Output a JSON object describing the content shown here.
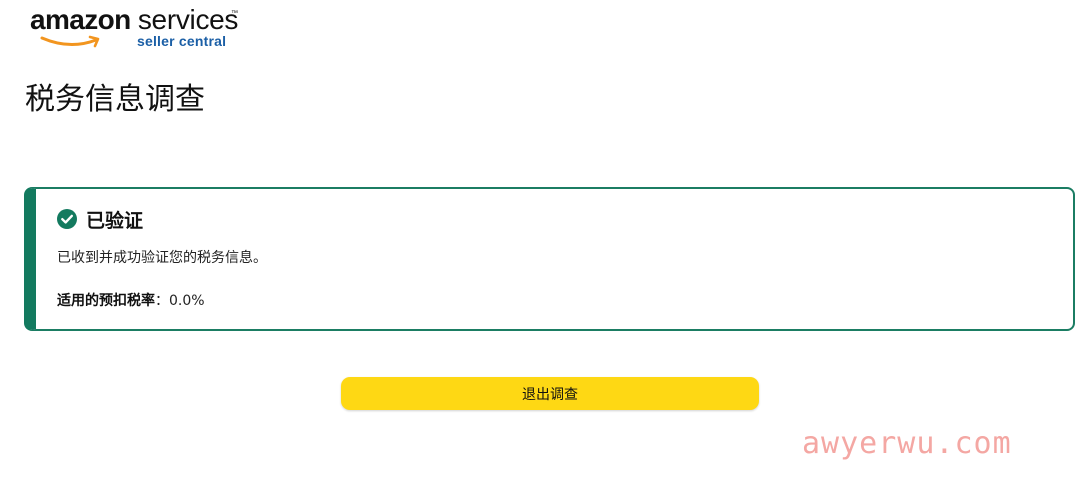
{
  "logo": {
    "brand": "amazon",
    "services": "services",
    "trademark": "™",
    "subtitle": "seller central",
    "subtitle_color": "#1b5fa6",
    "smile_color": "#f2951f"
  },
  "page": {
    "title": "税务信息调查"
  },
  "alert": {
    "icon": "check-circle-icon",
    "status_color": "#137a5f",
    "title": "已验证",
    "message": "已收到并成功验证您的税务信息。",
    "rate_label": "适用的预扣税率",
    "rate_separator": "：",
    "rate_value": "0.0%"
  },
  "actions": {
    "exit_label": "退出调查",
    "button_color": "#fed814"
  },
  "watermark": {
    "text": "awyerwu.com"
  }
}
